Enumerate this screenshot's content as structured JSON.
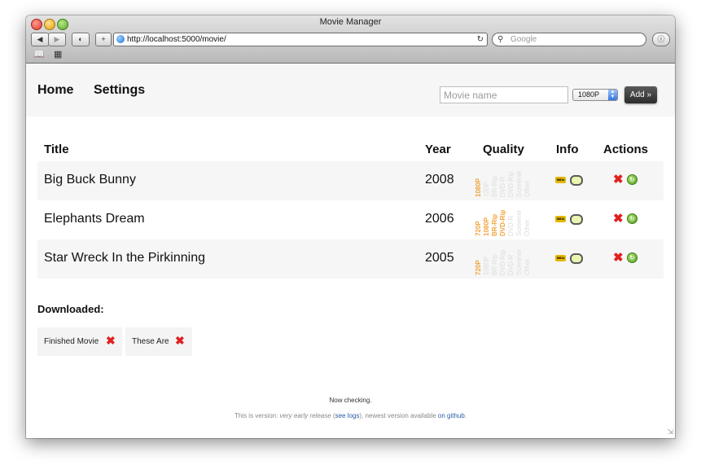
{
  "window": {
    "title": "Movie Manager"
  },
  "toolbar": {
    "back_icon": "back-arrow-icon",
    "forward_icon": "forward-arrow-icon",
    "url": "http://localhost:5000/movie/",
    "search_placeholder": "Google"
  },
  "nav": {
    "home": "Home",
    "settings": "Settings",
    "movie_placeholder": "Movie name",
    "quality_selected": "1080P",
    "add_label": "Add »"
  },
  "table": {
    "headers": {
      "title": "Title",
      "year": "Year",
      "quality": "Quality",
      "info": "Info",
      "actions": "Actions"
    },
    "rows": [
      {
        "title": "Big Buck Bunny",
        "year": "2008",
        "qualities": [
          {
            "label": "1080P",
            "on": true
          },
          {
            "label": "720P",
            "on": false
          },
          {
            "label": "BR-Rip",
            "on": false
          },
          {
            "label": "DVD-R",
            "on": false
          },
          {
            "label": "DVD-Rip",
            "on": false
          },
          {
            "label": "Screener",
            "on": false
          },
          {
            "label": "Other",
            "on": false
          }
        ]
      },
      {
        "title": "Elephants Dream",
        "year": "2006",
        "qualities": [
          {
            "label": "720P",
            "on": true
          },
          {
            "label": "1080P",
            "on": true
          },
          {
            "label": "BR-Rip",
            "on": true
          },
          {
            "label": "DVD-Rip",
            "on": true
          },
          {
            "label": "DVD-R",
            "on": false
          },
          {
            "label": "Screener",
            "on": false
          },
          {
            "label": "Other",
            "on": false
          }
        ]
      },
      {
        "title": "Star Wreck In the Pirkinning",
        "year": "2005",
        "qualities": [
          {
            "label": "720P",
            "on": true
          },
          {
            "label": "1080P",
            "on": false
          },
          {
            "label": "BR-Rip",
            "on": false
          },
          {
            "label": "DVD-Rip",
            "on": false
          },
          {
            "label": "DVD-R",
            "on": false
          },
          {
            "label": "Screener",
            "on": false
          },
          {
            "label": "Other",
            "on": false
          }
        ]
      }
    ],
    "imdb_label": "IMDb"
  },
  "downloaded": {
    "heading": "Downloaded:",
    "items": [
      "Finished Movie",
      "These Are"
    ]
  },
  "footer": {
    "status": "Now checking.",
    "version_prefix": "This is version: ",
    "version_value": "very early release",
    "logs_open": " (",
    "logs_link": "see logs",
    "logs_close": "), newest version available ",
    "github_link": "on github",
    "end": "."
  },
  "colors": {
    "quality_on": "#f0a43d",
    "quality_off": "#dcdcdc",
    "delete": "#e02020",
    "refresh": "#4f9e1c"
  }
}
